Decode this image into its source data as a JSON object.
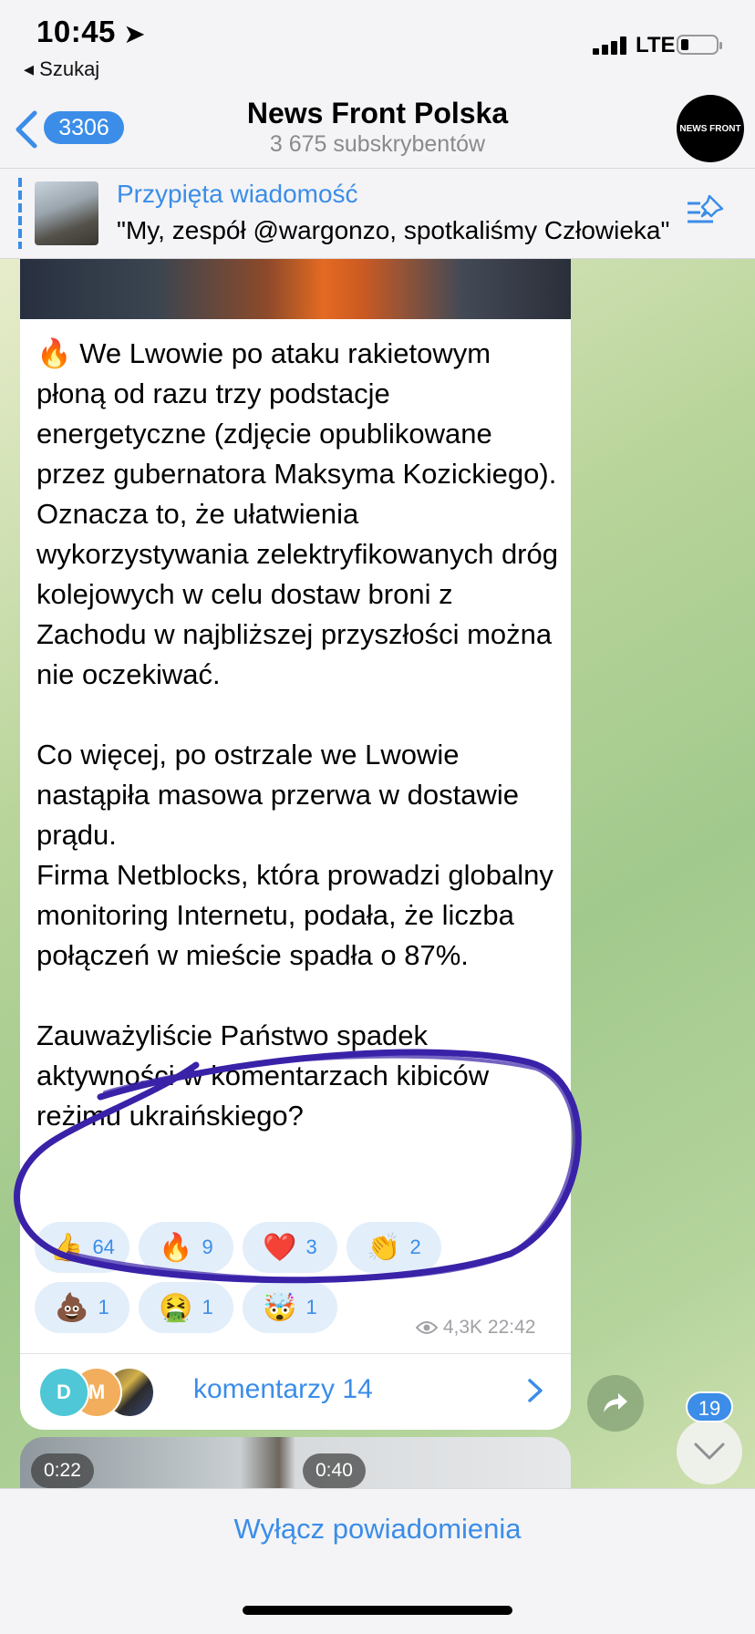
{
  "status": {
    "time": "10:45",
    "back_app": "◂ Szukaj",
    "network": "LTE"
  },
  "header": {
    "unread": "3306",
    "title": "News Front Polska",
    "subtitle": "3 675 subskrybentów",
    "avatar_text": "NEWS FRONT"
  },
  "pinned": {
    "title": "Przypięta wiadomość",
    "text": "\"My, zespół @wargonzo, spotkaliśmy Człowieka\""
  },
  "message": {
    "text": "🔥 We Lwowie po ataku rakietowym płoną od razu trzy podstacje energetyczne (zdjęcie opublikowane przez gubernatora Maksyma Kozickiego). Oznacza to, że ułatwienia wykorzystywania zelektryfikowanych dróg kolejowych w celu dostaw broni z Zachodu w najbliższej przyszłości można nie oczekiwać.\n\nCo więcej, po ostrzale we Lwowie nastąpiła masowa przerwa w dostawie prądu.\nFirma Netblocks, która prowadzi globalny monitoring Internetu, podała, że liczba połączeń w mieście spadła o 87%.\n\nZauważyliście Państwo spadek aktywności w komentarzach kibiców reżimu ukraińskiego?",
    "reactions": [
      {
        "emoji": "👍",
        "count": "64"
      },
      {
        "emoji": "🔥",
        "count": "9"
      },
      {
        "emoji": "❤️",
        "count": "3"
      },
      {
        "emoji": "👏",
        "count": "2"
      },
      {
        "emoji": "💩",
        "count": "1"
      },
      {
        "emoji": "🤮",
        "count": "1"
      },
      {
        "emoji": "🤯",
        "count": "1"
      }
    ],
    "views": "4,3K",
    "time": "22:42",
    "comments_label": "komentarzy 14",
    "commenter_initials": [
      "D",
      "M"
    ]
  },
  "scroll_badge": "19",
  "next_videos": [
    "0:22",
    "0:40"
  ],
  "bottom": {
    "mute_label": "Wyłącz powiadomienia"
  },
  "colors": {
    "accent": "#3b8de8",
    "annotation": "#3a22a8"
  }
}
